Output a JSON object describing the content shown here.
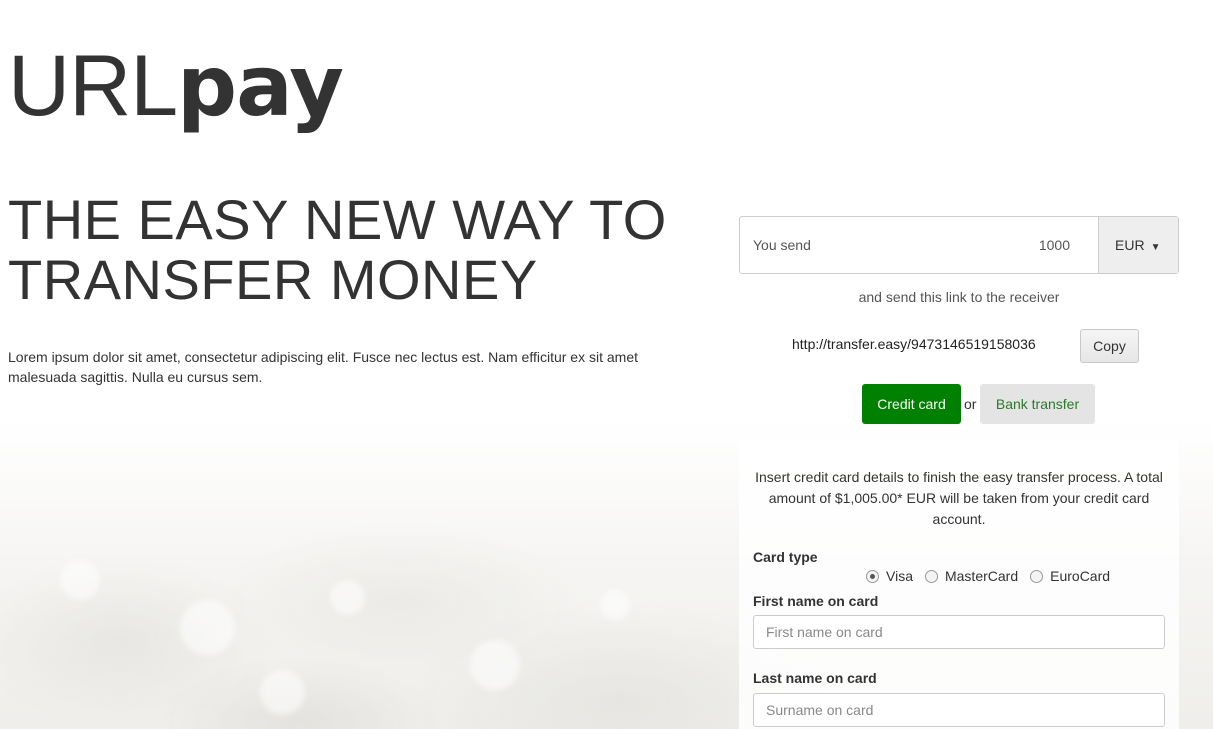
{
  "brand": {
    "light": "URL",
    "bold": "pay"
  },
  "hero": {
    "headline_line1": "THE EASY NEW WAY TO",
    "headline_line2": "TRANSFER MONEY",
    "intro": "Lorem ipsum dolor sit amet, consectetur adipiscing elit. Fusce nec lectus est. Nam efficitur ex sit amet malesuada sagittis. Nulla eu cursus sem."
  },
  "transfer": {
    "send_label": "You send",
    "amount": "1000",
    "currency": "EUR",
    "send_note": "and send this link to the receiver",
    "link": "http://transfer.easy/9473146519158036",
    "copy_label": "Copy",
    "credit_card_label": "Credit card",
    "or_label": "or",
    "bank_transfer_label": "Bank transfer"
  },
  "card_form": {
    "info": "Insert credit card details to finish the easy transfer process. A total amount of $1,005.00* EUR will be taken from your credit card account.",
    "card_type_label": "Card type",
    "card_types": [
      "Visa",
      "MasterCard",
      "EuroCard"
    ],
    "selected_card_type": "Visa",
    "first_name_label": "First name on card",
    "first_name_placeholder": "First name on card",
    "last_name_label": "Last name on card",
    "last_name_placeholder": "Surname on card"
  },
  "colors": {
    "primary_green": "#008000",
    "text": "#333333"
  }
}
